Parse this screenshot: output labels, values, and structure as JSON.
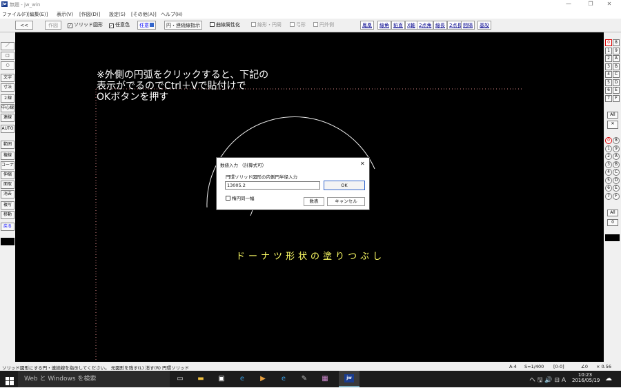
{
  "window": {
    "title": "無題 - jw_win",
    "app_icon": "jw",
    "minimize": "—",
    "maximize": "❐",
    "close": "✕"
  },
  "menu": [
    "ファイル(F)",
    "[編集(E)]",
    "表示(V)",
    "[作図(D)]",
    "設定(S)",
    "[その他(A)]",
    "ヘルプ(H)"
  ],
  "toolbar": {
    "back": "<<",
    "sakuzu": "作図",
    "solid": "ソリッド図形",
    "free_color": "任意色",
    "free_btn": "任意",
    "circle_link": "円・連続線指示",
    "curve_attr": "曲線属性化",
    "line_circle": "線形・円周",
    "arc": "弓形",
    "outer": "円外側",
    "right_buttons": [
      "鳳凰",
      "線角",
      "鉛直",
      "X軸",
      "2点角",
      "線長",
      "2点長",
      "間隔",
      "基設"
    ]
  },
  "left_tools": [
    "／",
    "□",
    "○",
    "文字",
    "寸法",
    "２線",
    "中心線",
    "連線",
    "AUTO",
    "範囲",
    "複線",
    "コーナー",
    "伸縮",
    "面取",
    "消去",
    "複写",
    "移動",
    "戻る"
  ],
  "right_layers": {
    "group1": [
      [
        "0",
        "8"
      ],
      [
        "1",
        "9"
      ],
      [
        "2",
        "A"
      ],
      [
        "3",
        "B"
      ],
      [
        "4",
        "C"
      ],
      [
        "5",
        "D"
      ],
      [
        "6",
        "E"
      ],
      [
        "7",
        "F"
      ]
    ],
    "group1_all": "All",
    "group1_x": "✕",
    "group2": [
      [
        "0",
        "8"
      ],
      [
        "1",
        "9"
      ],
      [
        "2",
        "A"
      ],
      [
        "3",
        "B"
      ],
      [
        "4",
        "C"
      ],
      [
        "5",
        "D"
      ],
      [
        "6",
        "E"
      ],
      [
        "7",
        "F"
      ]
    ],
    "group2_all": "All",
    "group2_zero": "0"
  },
  "canvas": {
    "note_line1": "※外側の円弧をクリックすると、下記の",
    "note_line2": "表示がでるのでCtrl＋Vで貼付けで",
    "note_line3": "OKボタンを押す",
    "donut_label": "ドーナツ形状の塗りつぶし",
    "note_color": "#ffffff",
    "donut_color": "#ffff66"
  },
  "dialog": {
    "title": "数値入力 （計算式可）",
    "close": "✕",
    "prompt": "円環ソリッド図形の内側円半径入力",
    "value": "13005.2",
    "ok": "OK",
    "checkbox": "楕円同一幅",
    "list": "数表",
    "cancel": "キャンセル"
  },
  "status": {
    "message": "ソリッド図形にする円・連続線を指示してください。 元図形を残す(L) 消す(R) 円環ソリッド",
    "scale_a": "A-4",
    "scale": "S=1/400",
    "layer": "[0-0]",
    "angle": "∠0",
    "zoom": "× 0.56"
  },
  "taskbar": {
    "search": "Web と Windows を検索",
    "tray": "ヘ 🖫 🔊 ⊟ A",
    "time": "10:23",
    "date": "2016/05/19"
  }
}
